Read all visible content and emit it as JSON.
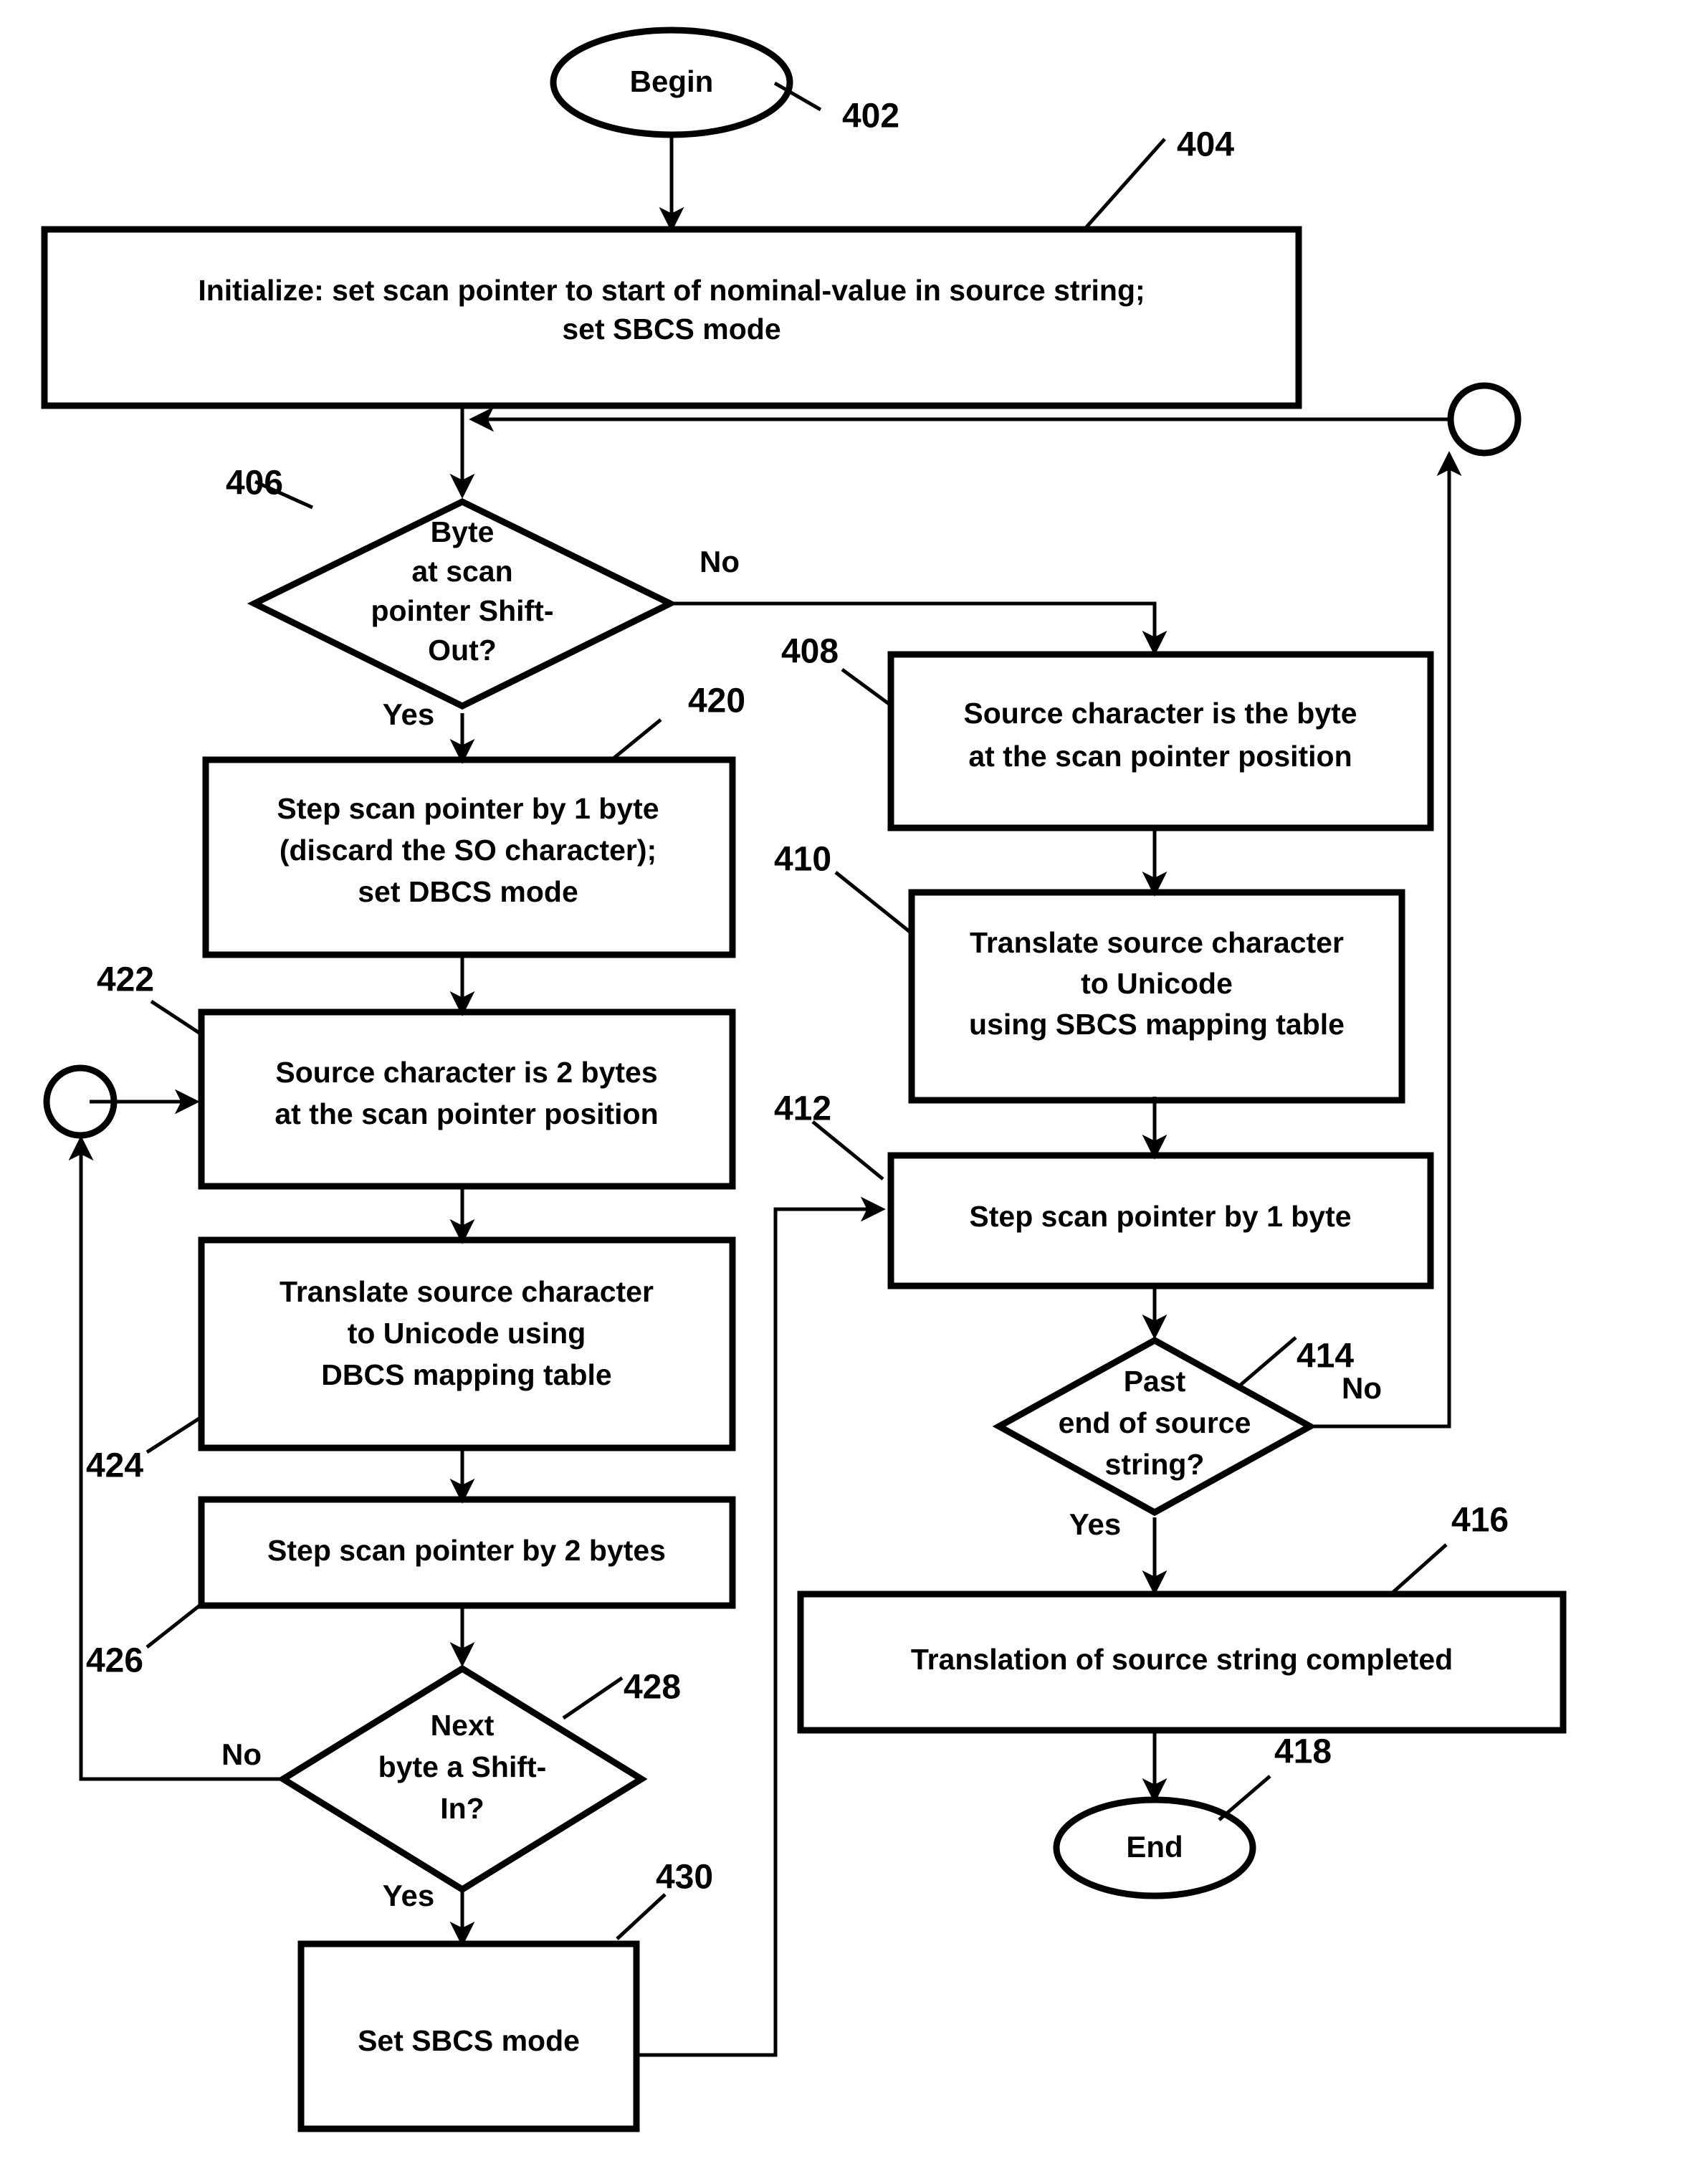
{
  "figure": {
    "type": "flowchart",
    "title": "SBCS/DBCS source string to Unicode translation flow"
  },
  "nodes": {
    "begin": {
      "ref": "402",
      "label": "Begin",
      "shape": "terminator-oval"
    },
    "initialize": {
      "ref": "404",
      "shape": "process-box",
      "line1": "Initialize:  set scan pointer to start of nominal-value in source string;",
      "line2": "set SBCS mode"
    },
    "decision_shift_out": {
      "ref": "406",
      "shape": "decision-diamond",
      "line1": "Byte",
      "line2": "at scan",
      "line3": "pointer Shift-",
      "line4": "Out?"
    },
    "source_char_byte": {
      "ref": "408",
      "shape": "process-box",
      "line1": "Source character is the byte",
      "line2": "at the scan pointer position"
    },
    "translate_sbcs": {
      "ref": "410",
      "shape": "process-box",
      "line1": "Translate source character",
      "line2": "to Unicode",
      "line3": "using SBCS mapping table"
    },
    "step_1_byte": {
      "ref": "412",
      "shape": "process-box",
      "line1": "Step scan pointer by 1 byte"
    },
    "decision_past_end": {
      "ref": "414",
      "shape": "decision-diamond",
      "line1": "Past",
      "line2": "end of source",
      "line3": "string?"
    },
    "translation_completed": {
      "ref": "416",
      "shape": "process-box",
      "line1": "Translation of source string completed"
    },
    "end": {
      "ref": "418",
      "label": "End",
      "shape": "terminator-oval"
    },
    "step_1_byte_discard_so": {
      "ref": "420",
      "shape": "process-box",
      "line1": "Step scan pointer by 1 byte",
      "line2": "(discard the SO character);",
      "line3": "set DBCS mode"
    },
    "source_char_2_bytes": {
      "ref": "422",
      "shape": "process-box",
      "line1": "Source character is 2 bytes",
      "line2": "at the scan pointer position"
    },
    "translate_dbcs": {
      "ref": "424",
      "shape": "process-box",
      "line1": "Translate source character",
      "line2": "to Unicode using",
      "line3": "DBCS mapping table"
    },
    "step_2_bytes": {
      "ref": "426",
      "shape": "process-box",
      "line1": "Step scan pointer by 2 bytes"
    },
    "decision_shift_in": {
      "ref": "428",
      "shape": "decision-diamond",
      "line1": "Next",
      "line2": "byte a Shift-",
      "line3": "In?"
    },
    "set_sbcs_mode": {
      "ref": "430",
      "shape": "process-box",
      "line1": "Set SBCS mode"
    },
    "connector_left": {
      "shape": "off-page-circle",
      "label": ""
    },
    "connector_right": {
      "shape": "off-page-circle",
      "label": ""
    }
  },
  "branch_labels": {
    "shift_out_no": "No",
    "shift_out_yes": "Yes",
    "past_end_no": "No",
    "past_end_yes": "Yes",
    "shift_in_no": "No",
    "shift_in_yes": "Yes"
  },
  "colors": {
    "line": "#000000",
    "fill": "#ffffff",
    "text": "#000000"
  }
}
